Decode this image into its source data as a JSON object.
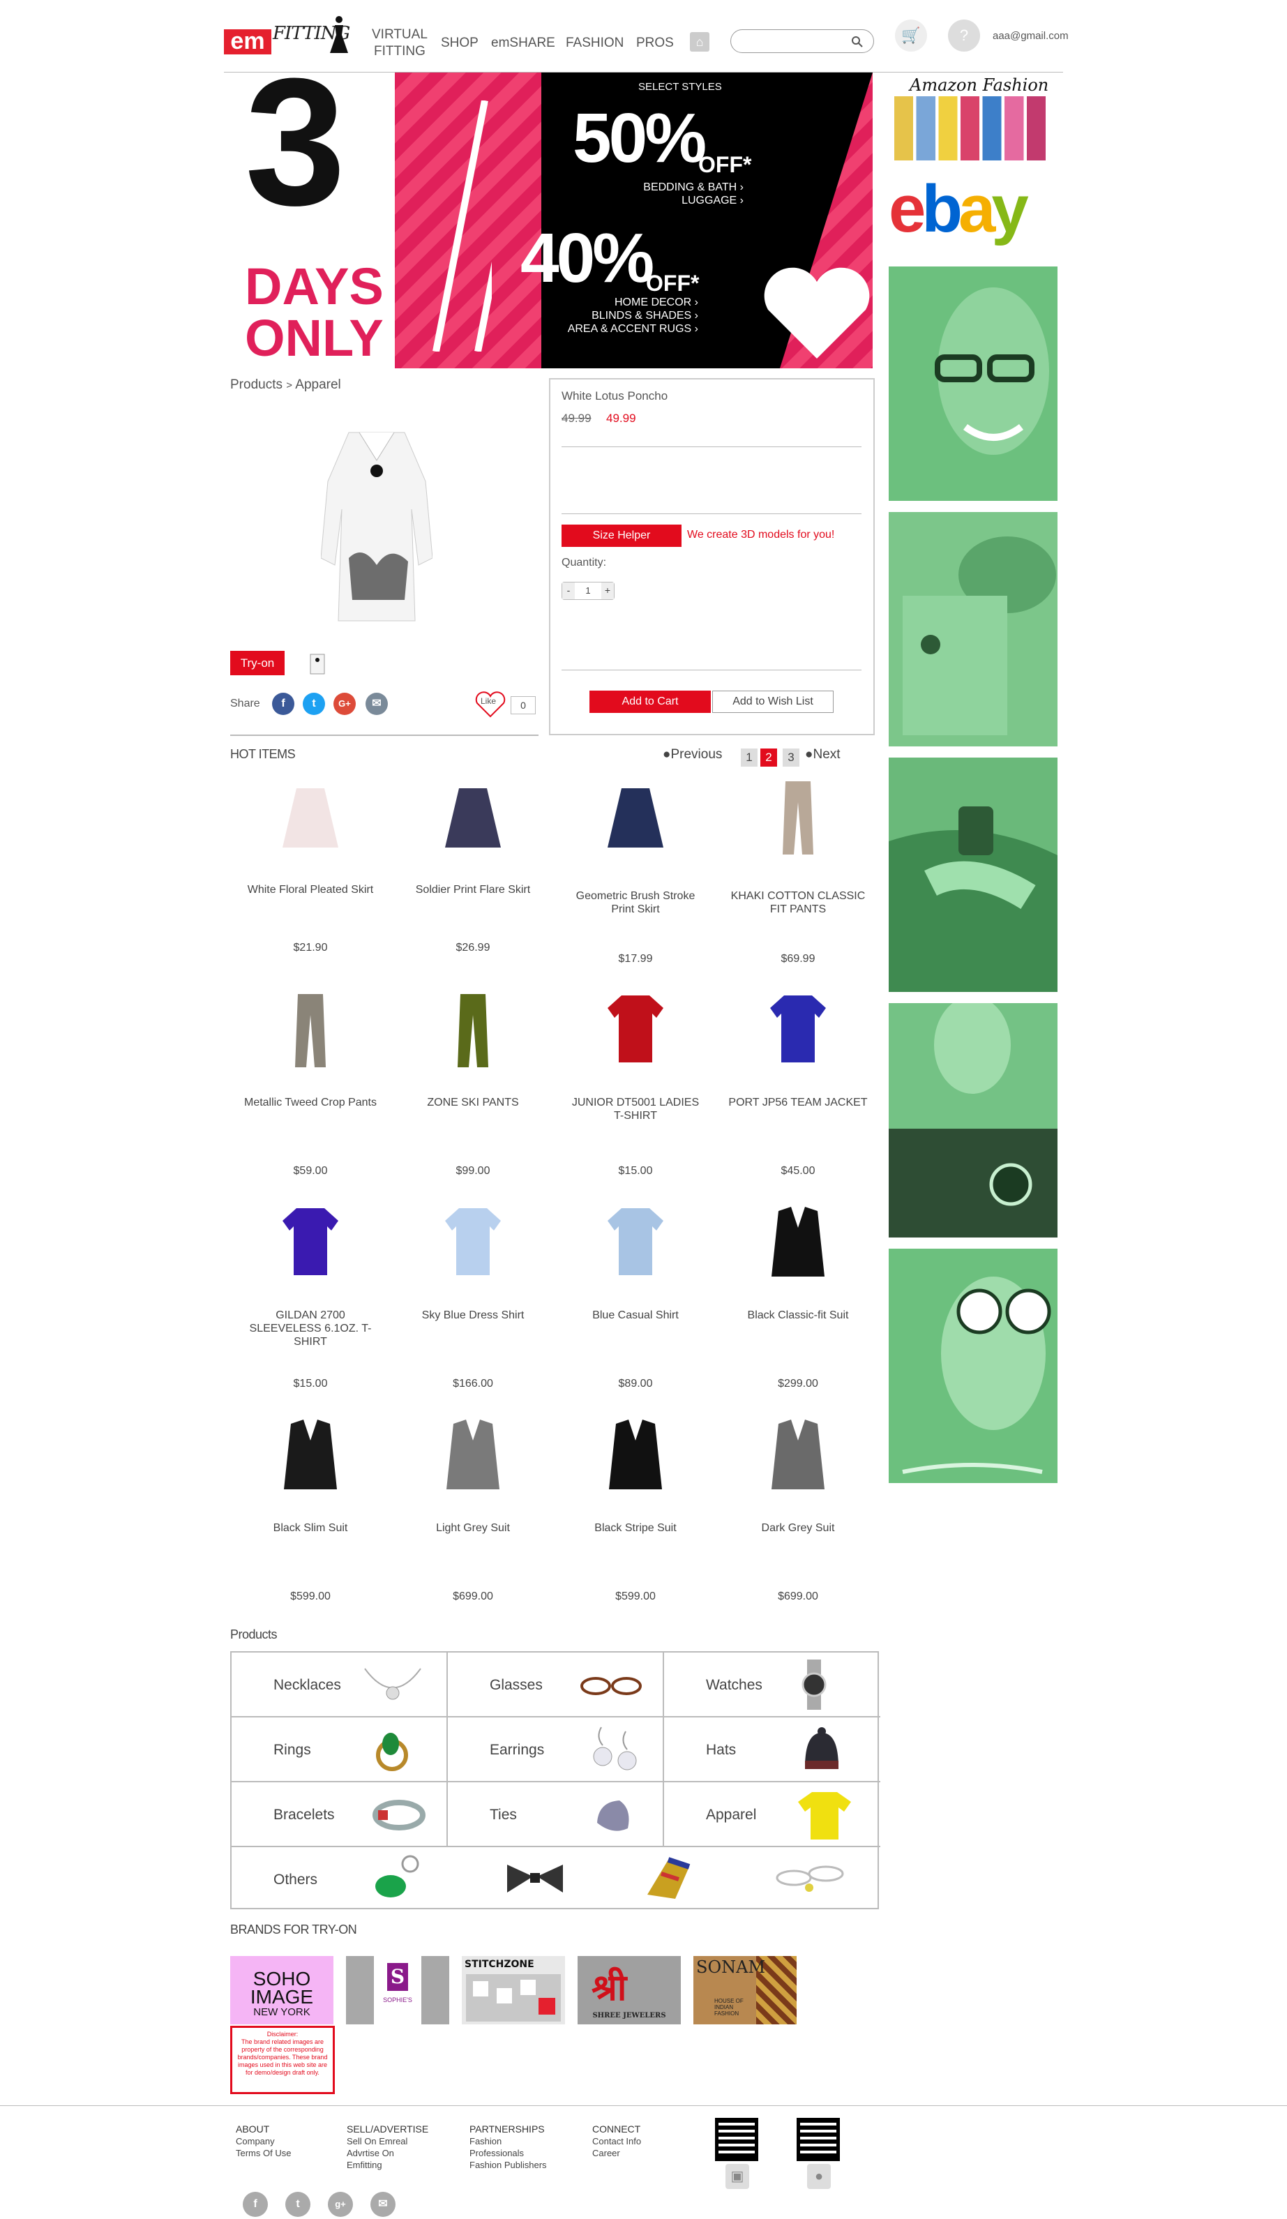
{
  "header": {
    "logo_em": "em",
    "logo_fitting": "FITTING",
    "nav": [
      {
        "label_line1": "VIRTUAL",
        "label_line2": "FITTING"
      },
      {
        "label_line1": "SHOP",
        "label_line2": ""
      },
      {
        "label_line1": "emSHARE",
        "label_line2": ""
      },
      {
        "label_line1": "FASHION",
        "label_line2": ""
      },
      {
        "label_line1": "PROS",
        "label_line2": ""
      }
    ],
    "search_placeholder": "",
    "user_email": "aaa@gmail.com"
  },
  "banner": {
    "big_number": "3",
    "days": "DAYS",
    "only": "ONLY",
    "select_styles": "SELECT STYLES",
    "offer1_pct": "50%",
    "offer1_off": "OFF*",
    "offer1_items": [
      "BEDDING & BATH ›",
      "LUGGAGE ›"
    ],
    "offer2_pct": "40%",
    "offer2_off": "OFF*",
    "offer2_items": [
      "HOME DECOR ›",
      "BLINDS & SHADES ›",
      "AREA & ACCENT RUGS ›"
    ]
  },
  "ads": {
    "amazon": "Amazon Fashion",
    "ebay_letters": [
      "e",
      "b",
      "a",
      "y"
    ]
  },
  "breadcrumb": {
    "root": "Products",
    "sep": ">",
    "current": "Apparel"
  },
  "product": {
    "name": "White Lotus Poncho",
    "old_price": "49.99",
    "price": "49.99",
    "size_helper": "Size Helper",
    "size_note": "We create 3D models for you!",
    "quantity_label": "Quantity:",
    "qty_minus": "-",
    "qty_value": "1",
    "qty_plus": "+",
    "add_to_cart": "Add to Cart",
    "add_to_wishlist": "Add to Wish List",
    "tryon": "Try-on",
    "share": "Share",
    "like": "Like",
    "like_count": "0"
  },
  "hot": {
    "title": "HOT ITEMS",
    "previous": "●Previous",
    "next": "●Next",
    "pages": [
      "1",
      "2",
      "3"
    ],
    "current_page": "2",
    "items": [
      {
        "name": "White Floral Pleated Skirt",
        "price": "$21.90"
      },
      {
        "name": "Soldier Print Flare Skirt",
        "price": "$26.99"
      },
      {
        "name": "Geometric Brush Stroke Print Skirt",
        "price": "$17.99"
      },
      {
        "name": "KHAKI COTTON CLASSIC FIT PANTS",
        "price": "$69.99"
      },
      {
        "name": "Metallic Tweed Crop Pants",
        "price": "$59.00"
      },
      {
        "name": "ZONE SKI PANTS",
        "price": "$99.00"
      },
      {
        "name": "JUNIOR DT5001 LADIES T-SHIRT",
        "price": "$15.00"
      },
      {
        "name": "PORT JP56 TEAM JACKET",
        "price": "$45.00"
      },
      {
        "name": "GILDAN 2700 SLEEVELESS 6.1OZ. T-SHIRT",
        "price": "$15.00"
      },
      {
        "name": "Sky Blue Dress Shirt",
        "price": "$166.00"
      },
      {
        "name": "Blue Casual Shirt",
        "price": "$89.00"
      },
      {
        "name": "Black Classic-fit Suit",
        "price": "$299.00"
      },
      {
        "name": "Black Slim Suit",
        "price": "$599.00"
      },
      {
        "name": "Light Grey Suit",
        "price": "$699.00"
      },
      {
        "name": "Black Stripe Suit",
        "price": "$599.00"
      },
      {
        "name": "Dark Grey Suit",
        "price": "$699.00"
      }
    ]
  },
  "categories": {
    "title": "Products",
    "items": [
      "Necklaces",
      "Glasses",
      "Watches",
      "Rings",
      "Earrings",
      "Hats",
      "Bracelets",
      "Ties",
      "Apparel",
      "Others"
    ]
  },
  "brands": {
    "title": "BRANDS FOR TRY-ON",
    "soho": [
      "SOHO",
      "IMAGE",
      "NEW YORK"
    ],
    "sophies": "SOPHIE'S",
    "stitchzone": "STITCHZONE",
    "shree": "SHREE JEWELERS",
    "sonam": "SONAM",
    "sonam_sub": "HOUSE OF INDIAN FASHION",
    "disclaimer_title": "Disclaimer:",
    "disclaimer": "The brand related images are property of the corresponding brands/companies. These brand images used in this web site are for demo/design draft only."
  },
  "footer": {
    "about": {
      "title": "ABOUT",
      "links": [
        "Company",
        "Terms Of Use"
      ]
    },
    "sell": {
      "title": "SELL/ADVERTISE",
      "links": [
        "Sell On Emreal",
        "Advrtise On",
        "Emfitting"
      ]
    },
    "partnerships": {
      "title": "PARTNERSHIPS",
      "links": [
        "Fashion",
        "Professionals",
        "Fashion Publishers"
      ]
    },
    "connect": {
      "title": "CONNECT",
      "links": [
        "Contact Info",
        "Career"
      ]
    }
  },
  "colors": {
    "accent": "#e20b1d",
    "ad_green": "#6cc07e"
  }
}
